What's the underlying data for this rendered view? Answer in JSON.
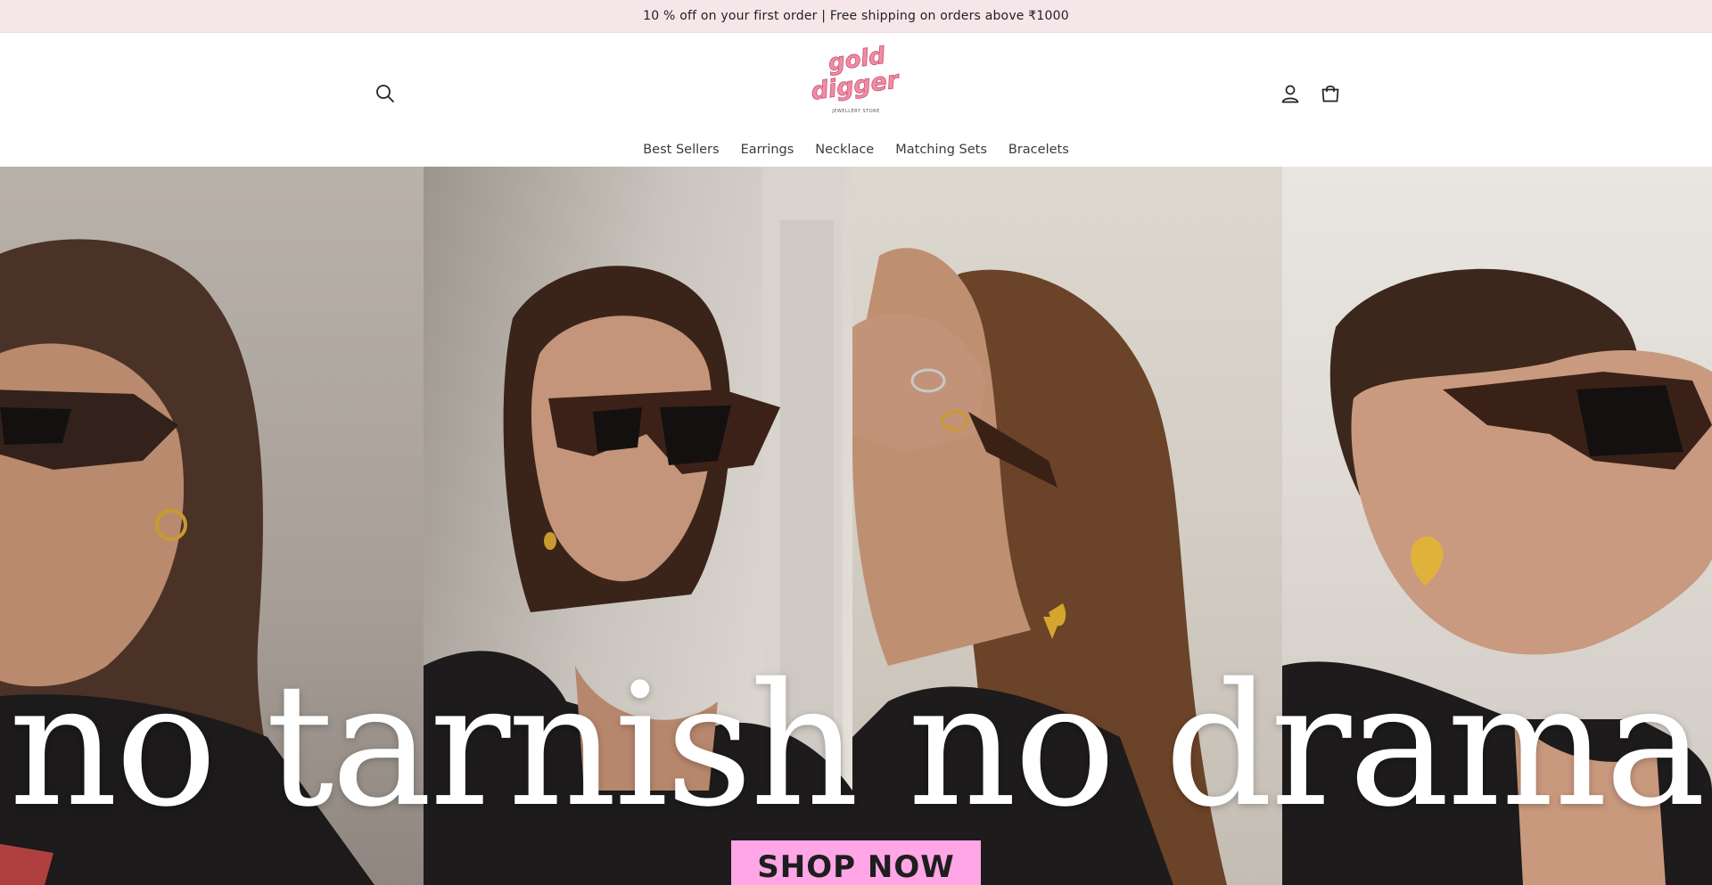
{
  "announcement": {
    "text": "10 % off on your first order | Free shipping on orders above ₹1000"
  },
  "header": {
    "logo": {
      "line1": "gold",
      "line2": "digger",
      "tagline": "JEWELLERY STORE"
    },
    "icons": {
      "search": "search-icon",
      "account": "account-icon",
      "cart": "cart-icon"
    }
  },
  "nav": {
    "items": [
      {
        "label": "Best Sellers"
      },
      {
        "label": "Earrings"
      },
      {
        "label": "Necklace"
      },
      {
        "label": "Matching Sets"
      },
      {
        "label": "Bracelets"
      }
    ]
  },
  "hero": {
    "title": "no tarnish no drama",
    "cta": "SHOP NOW"
  },
  "colors": {
    "announcement_bg": "#f5e6ea",
    "logo_pink": "#f48aa6",
    "cta_pink": "#ffa6e6",
    "nav_text": "#3b3b3b"
  }
}
